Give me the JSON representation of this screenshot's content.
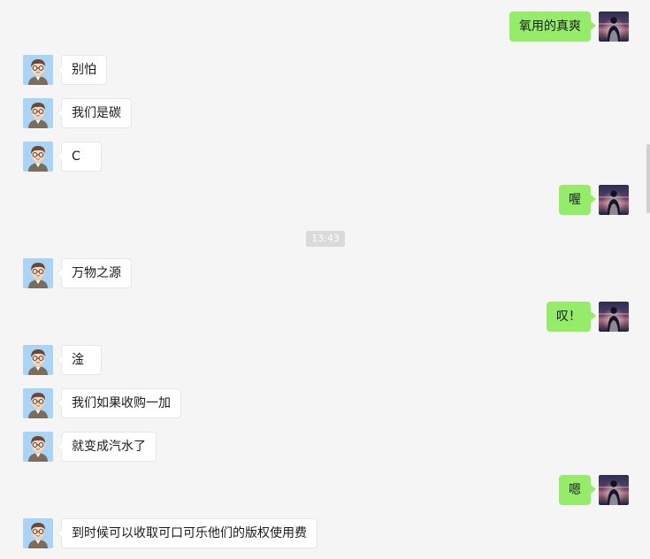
{
  "colors": {
    "background": "#f5f5f5",
    "self_bubble": "#95ec69",
    "other_bubble": "#ffffff",
    "timestamp_bg": "#dadada"
  },
  "timestamp": "13:43",
  "messages": [
    {
      "side": "right",
      "text": "氧用的真爽",
      "avatar": "dark-sky-silhouette-avatar"
    },
    {
      "side": "left",
      "text": "别怕",
      "avatar": "cartoon-boy-glasses-avatar"
    },
    {
      "side": "left",
      "text": "我们是碳",
      "avatar": "cartoon-boy-glasses-avatar"
    },
    {
      "side": "left",
      "text": "C",
      "avatar": "cartoon-boy-glasses-avatar"
    },
    {
      "side": "right",
      "text": "喔",
      "avatar": "dark-sky-silhouette-avatar"
    },
    {
      "side": "left",
      "text": "万物之源",
      "avatar": "cartoon-boy-glasses-avatar"
    },
    {
      "side": "right",
      "text": "叹！",
      "avatar": "dark-sky-silhouette-avatar"
    },
    {
      "side": "left",
      "text": "淦",
      "avatar": "cartoon-boy-glasses-avatar"
    },
    {
      "side": "left",
      "text": "我们如果收购一加",
      "avatar": "cartoon-boy-glasses-avatar"
    },
    {
      "side": "left",
      "text": "就变成汽水了",
      "avatar": "cartoon-boy-glasses-avatar"
    },
    {
      "side": "right",
      "text": "嗯",
      "avatar": "dark-sky-silhouette-avatar"
    },
    {
      "side": "left",
      "text": "到时候可以收取可口可乐他们的版权使用费",
      "avatar": "cartoon-boy-glasses-avatar"
    }
  ]
}
